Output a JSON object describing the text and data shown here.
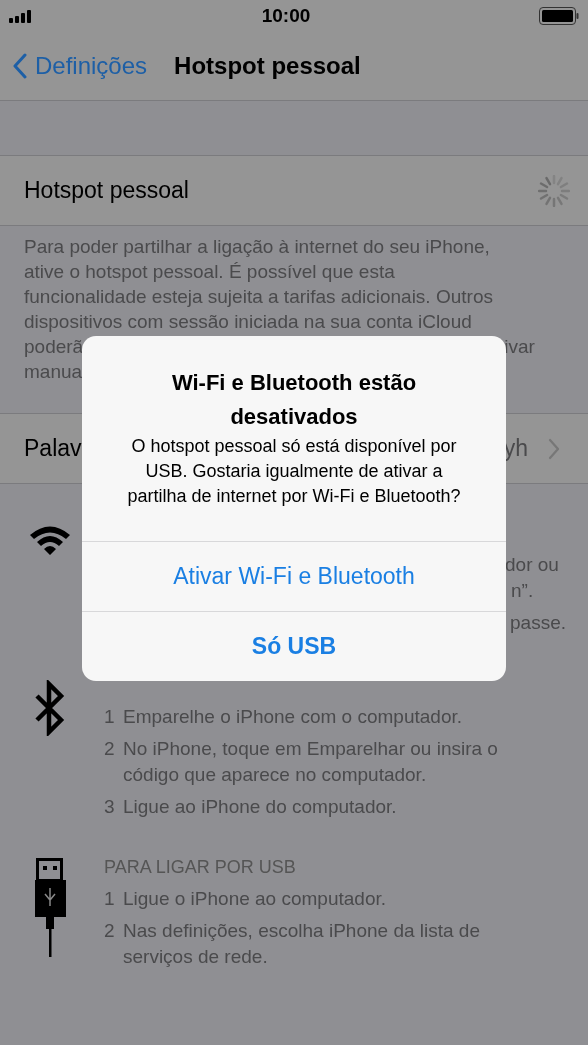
{
  "status_bar": {
    "time": "10:00"
  },
  "nav": {
    "back": "Definições",
    "title": "Hotspot pessoal"
  },
  "hotspot_row": {
    "label": "Hotspot pessoal",
    "loading": true
  },
  "description": {
    "lines": [
      "Para poder partilhar a ligação à internet do seu iPhone,",
      "ative o hotspot pessoal. É possível que esta",
      "funcionalidade esteja sujeita a tarifas adicionais. Outros",
      "dispositivos com sessão iniciada na sua conta iCloud"
    ],
    "partial_line_start": "poderã",
    "partial_line_end": "ivar",
    "last_line_start": "manua"
  },
  "password_row": {
    "label": "Palav",
    "value": "yh"
  },
  "wifi_section": {
    "fragments": [
      "dor ou",
      "n”.",
      "passe."
    ]
  },
  "bluetooth_section": {
    "steps": [
      {
        "number": "1",
        "text": "Emparelhe o iPhone com o computador."
      },
      {
        "number": "2",
        "text": "No iPhone, toque em Emparelhar ou insira o código que aparece no computador."
      },
      {
        "number": "3",
        "text": "Ligue ao iPhone do computador."
      }
    ]
  },
  "usb_section": {
    "heading": "PARA LIGAR POR USB",
    "steps": [
      {
        "number": "1",
        "text": "Ligue o iPhone ao computador."
      },
      {
        "number": "2",
        "text": "Nas definições, escolha iPhone da lista de serviços de rede."
      }
    ]
  },
  "alert": {
    "title": "Wi-Fi e Bluetooth estão desativados",
    "message": "O hotspot pessoal só está disponível por USB. Gostaria igualmente de ativar a partilha de internet por Wi-Fi e Bluetooth?",
    "actions": [
      {
        "label": "Ativar Wi-Fi e Bluetooth",
        "preferred": false
      },
      {
        "label": "Só USB",
        "preferred": true
      }
    ]
  }
}
